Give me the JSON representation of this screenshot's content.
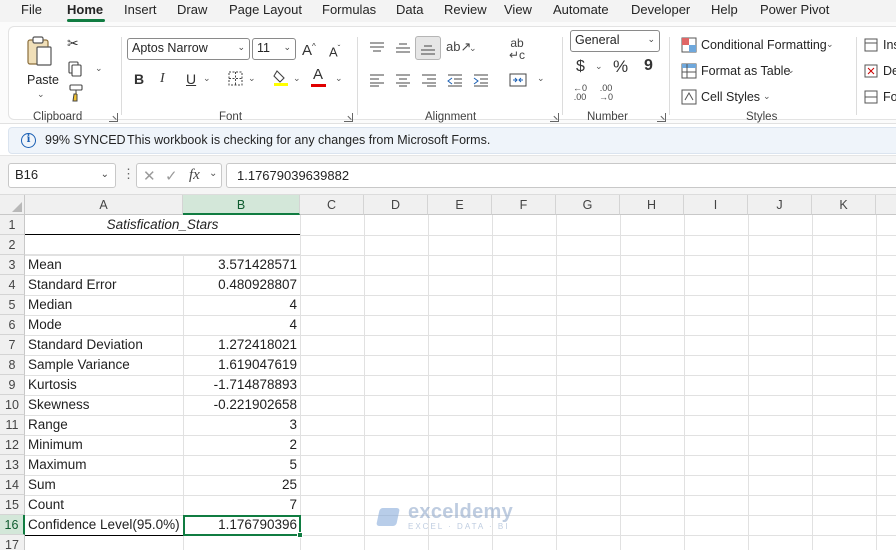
{
  "menu": {
    "items": [
      "File",
      "Home",
      "Insert",
      "Draw",
      "Page Layout",
      "Formulas",
      "Data",
      "Review",
      "View",
      "Automate",
      "Developer",
      "Help",
      "Power Pivot"
    ],
    "active": "Home"
  },
  "ribbon": {
    "clipboard": {
      "label": "Clipboard",
      "paste_label": "Paste"
    },
    "font": {
      "label": "Font",
      "font_name": "Aptos Narrow",
      "font_size": "11",
      "bold": "B",
      "italic": "I",
      "underline": "U"
    },
    "alignment": {
      "label": "Alignment"
    },
    "number": {
      "label": "Number",
      "format": "General",
      "currency": "$",
      "percent": "%",
      "comma": "9"
    },
    "styles": {
      "label": "Styles",
      "conditional_formatting": "Conditional Formatting",
      "format_as_table": "Format as Table",
      "cell_styles": "Cell Styles"
    },
    "cells": {
      "insert": "Ins",
      "delete": "De",
      "format": "Fo"
    }
  },
  "infobar": {
    "status": "99% SYNCED",
    "message": "This workbook is checking for any changes from Microsoft Forms."
  },
  "formula_bar": {
    "name_box": "B16",
    "fx": "fx",
    "formula": "1.17679039639882"
  },
  "grid": {
    "columns": [
      "A",
      "B",
      "C",
      "D",
      "E",
      "F",
      "G",
      "H",
      "I",
      "J",
      "K"
    ],
    "rows": [
      "1",
      "2",
      "3",
      "4",
      "5",
      "6",
      "7",
      "8",
      "9",
      "10",
      "11",
      "12",
      "13",
      "14",
      "15",
      "16",
      "17"
    ],
    "selected_column": "B",
    "selected_row": "16",
    "header": "Satisfication_Stars",
    "stats": [
      {
        "label": "Mean",
        "value": "3.571428571"
      },
      {
        "label": "Standard Error",
        "value": "0.480928807"
      },
      {
        "label": "Median",
        "value": "4"
      },
      {
        "label": "Mode",
        "value": "4"
      },
      {
        "label": "Standard Deviation",
        "value": "1.272418021"
      },
      {
        "label": "Sample Variance",
        "value": "1.619047619"
      },
      {
        "label": "Kurtosis",
        "value": "-1.714878893"
      },
      {
        "label": "Skewness",
        "value": "-0.221902658"
      },
      {
        "label": "Range",
        "value": "3"
      },
      {
        "label": "Minimum",
        "value": "2"
      },
      {
        "label": "Maximum",
        "value": "5"
      },
      {
        "label": "Sum",
        "value": "25"
      },
      {
        "label": "Count",
        "value": "7"
      },
      {
        "label": "Confidence Level(95.0%)",
        "value": "1.176790396"
      }
    ]
  },
  "watermark": {
    "name": "exceldemy",
    "tagline": "EXCEL · DATA · BI"
  },
  "colors": {
    "accent": "#107c41",
    "info": "#1a5fb4"
  }
}
